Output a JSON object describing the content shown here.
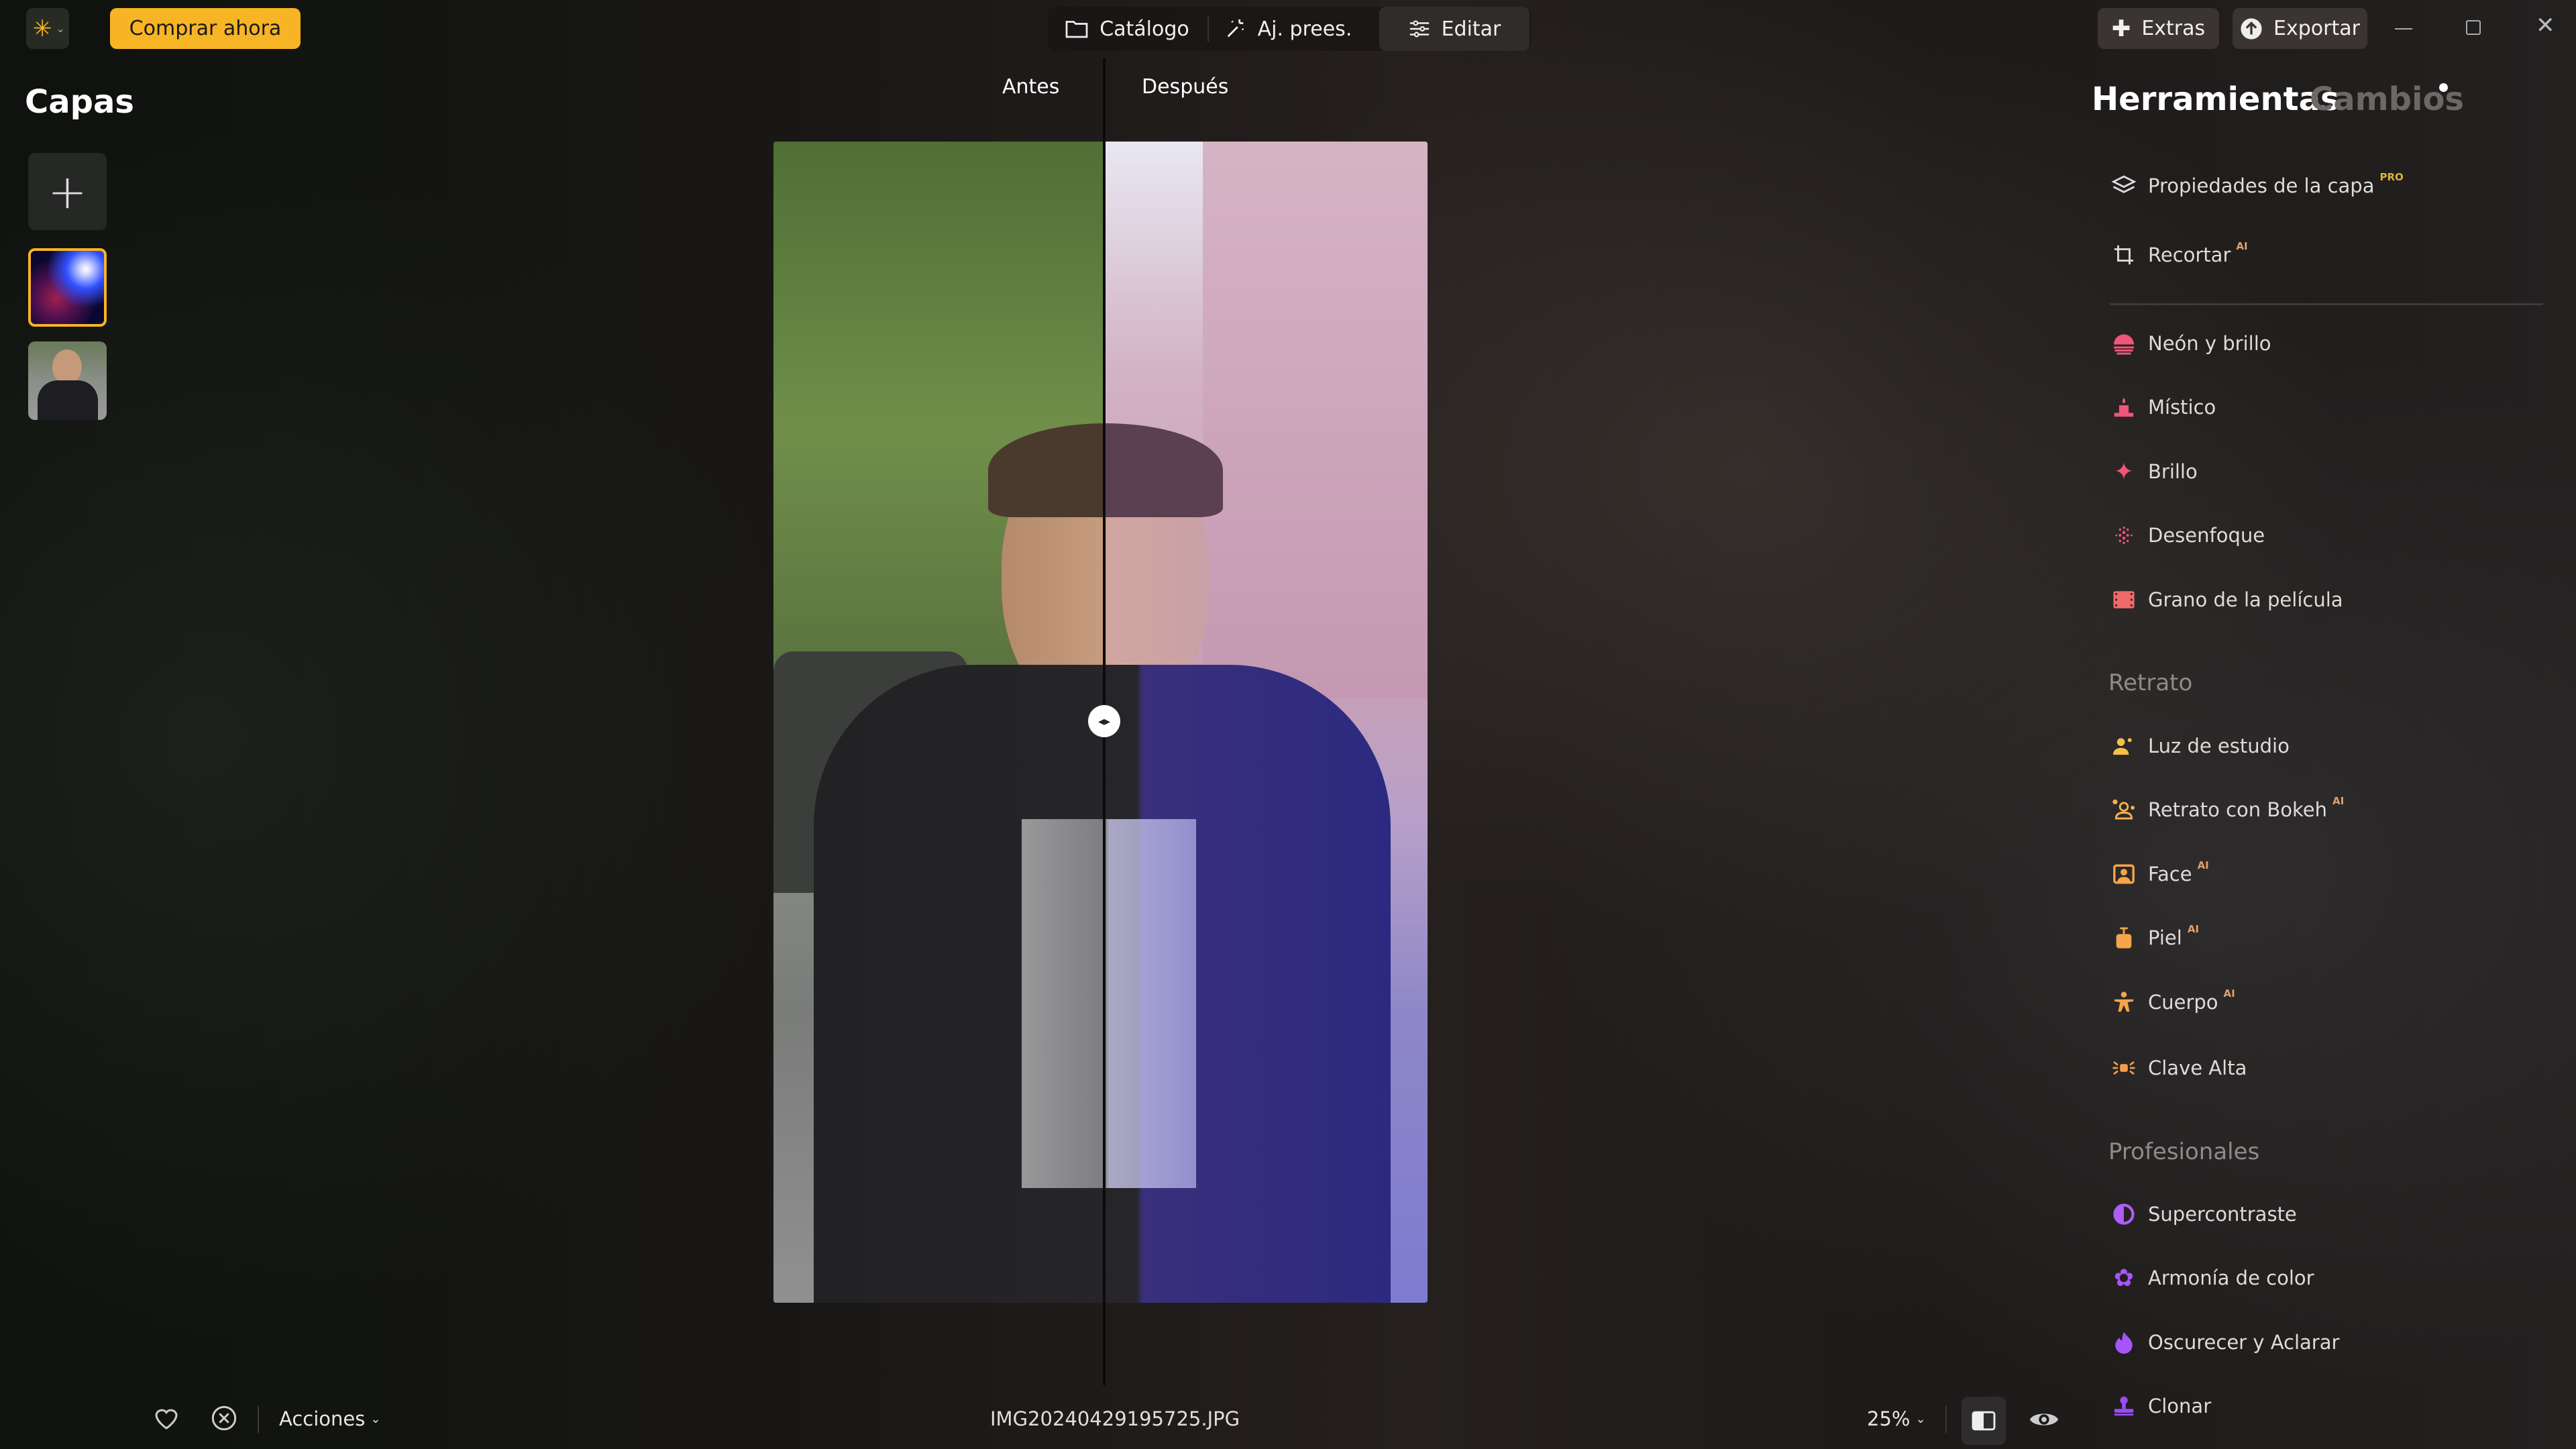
{
  "topbar": {
    "buy_label": "Comprar ahora",
    "nav": [
      {
        "label": "Catálogo",
        "icon": "folder-icon"
      },
      {
        "label": "Aj. prees.",
        "icon": "magic-wand-icon"
      },
      {
        "label": "Editar",
        "icon": "sliders-icon",
        "active": true
      }
    ],
    "extras_label": "Extras",
    "export_label": "Exportar"
  },
  "layers": {
    "title": "Capas"
  },
  "compare": {
    "before_label": "Antes",
    "after_label": "Después",
    "split_position": 0.5
  },
  "panel": {
    "tabs": [
      {
        "label": "Herramientas",
        "active": true
      },
      {
        "label": "Cambios",
        "has_dot": true
      }
    ],
    "items_top": [
      {
        "label": "Propiedades de la capa",
        "badge": "PRO",
        "icon": "layers-icon"
      },
      {
        "label": "Recortar",
        "badge": "AI",
        "icon": "crop-icon"
      }
    ],
    "items_effects": [
      {
        "label": "Neón y brillo",
        "icon": "neon-sunset-icon"
      },
      {
        "label": "Místico",
        "icon": "candle-icon"
      },
      {
        "label": "Brillo",
        "icon": "sparkle-icon"
      },
      {
        "label": "Desenfoque",
        "icon": "blur-dots-icon"
      },
      {
        "label": "Grano de la película",
        "icon": "film-icon"
      }
    ],
    "portrait_header": "Retrato",
    "items_portrait": [
      {
        "label": "Luz de estudio",
        "icon": "studio-light-icon"
      },
      {
        "label": "Retrato con Bokeh",
        "badge": "AI",
        "icon": "bokeh-portrait-icon"
      },
      {
        "label": "Face",
        "badge": "AI",
        "icon": "face-frame-icon"
      },
      {
        "label": "Piel",
        "badge": "AI",
        "icon": "skin-bottle-icon"
      },
      {
        "label": "Cuerpo",
        "badge": "AI",
        "icon": "body-icon"
      },
      {
        "label": "Clave Alta",
        "icon": "high-key-icon"
      }
    ],
    "pro_header": "Profesionales",
    "items_pro": [
      {
        "label": "Supercontraste",
        "icon": "contrast-icon"
      },
      {
        "label": "Armonía de color",
        "icon": "flower-icon"
      },
      {
        "label": "Oscurecer y Aclarar",
        "icon": "flame-icon"
      },
      {
        "label": "Clonar",
        "icon": "stamp-icon"
      }
    ]
  },
  "bottombar": {
    "actions_label": "Acciones",
    "filename": "IMG20240429195725.JPG",
    "zoom": "25%"
  },
  "colors": {
    "accent": "#f7b425",
    "pro_badge": "#d9b43a",
    "ai_badge": "#e0a070",
    "effects": "#f0557a",
    "portrait": "#f5a54a",
    "pro": "#a855f7"
  }
}
